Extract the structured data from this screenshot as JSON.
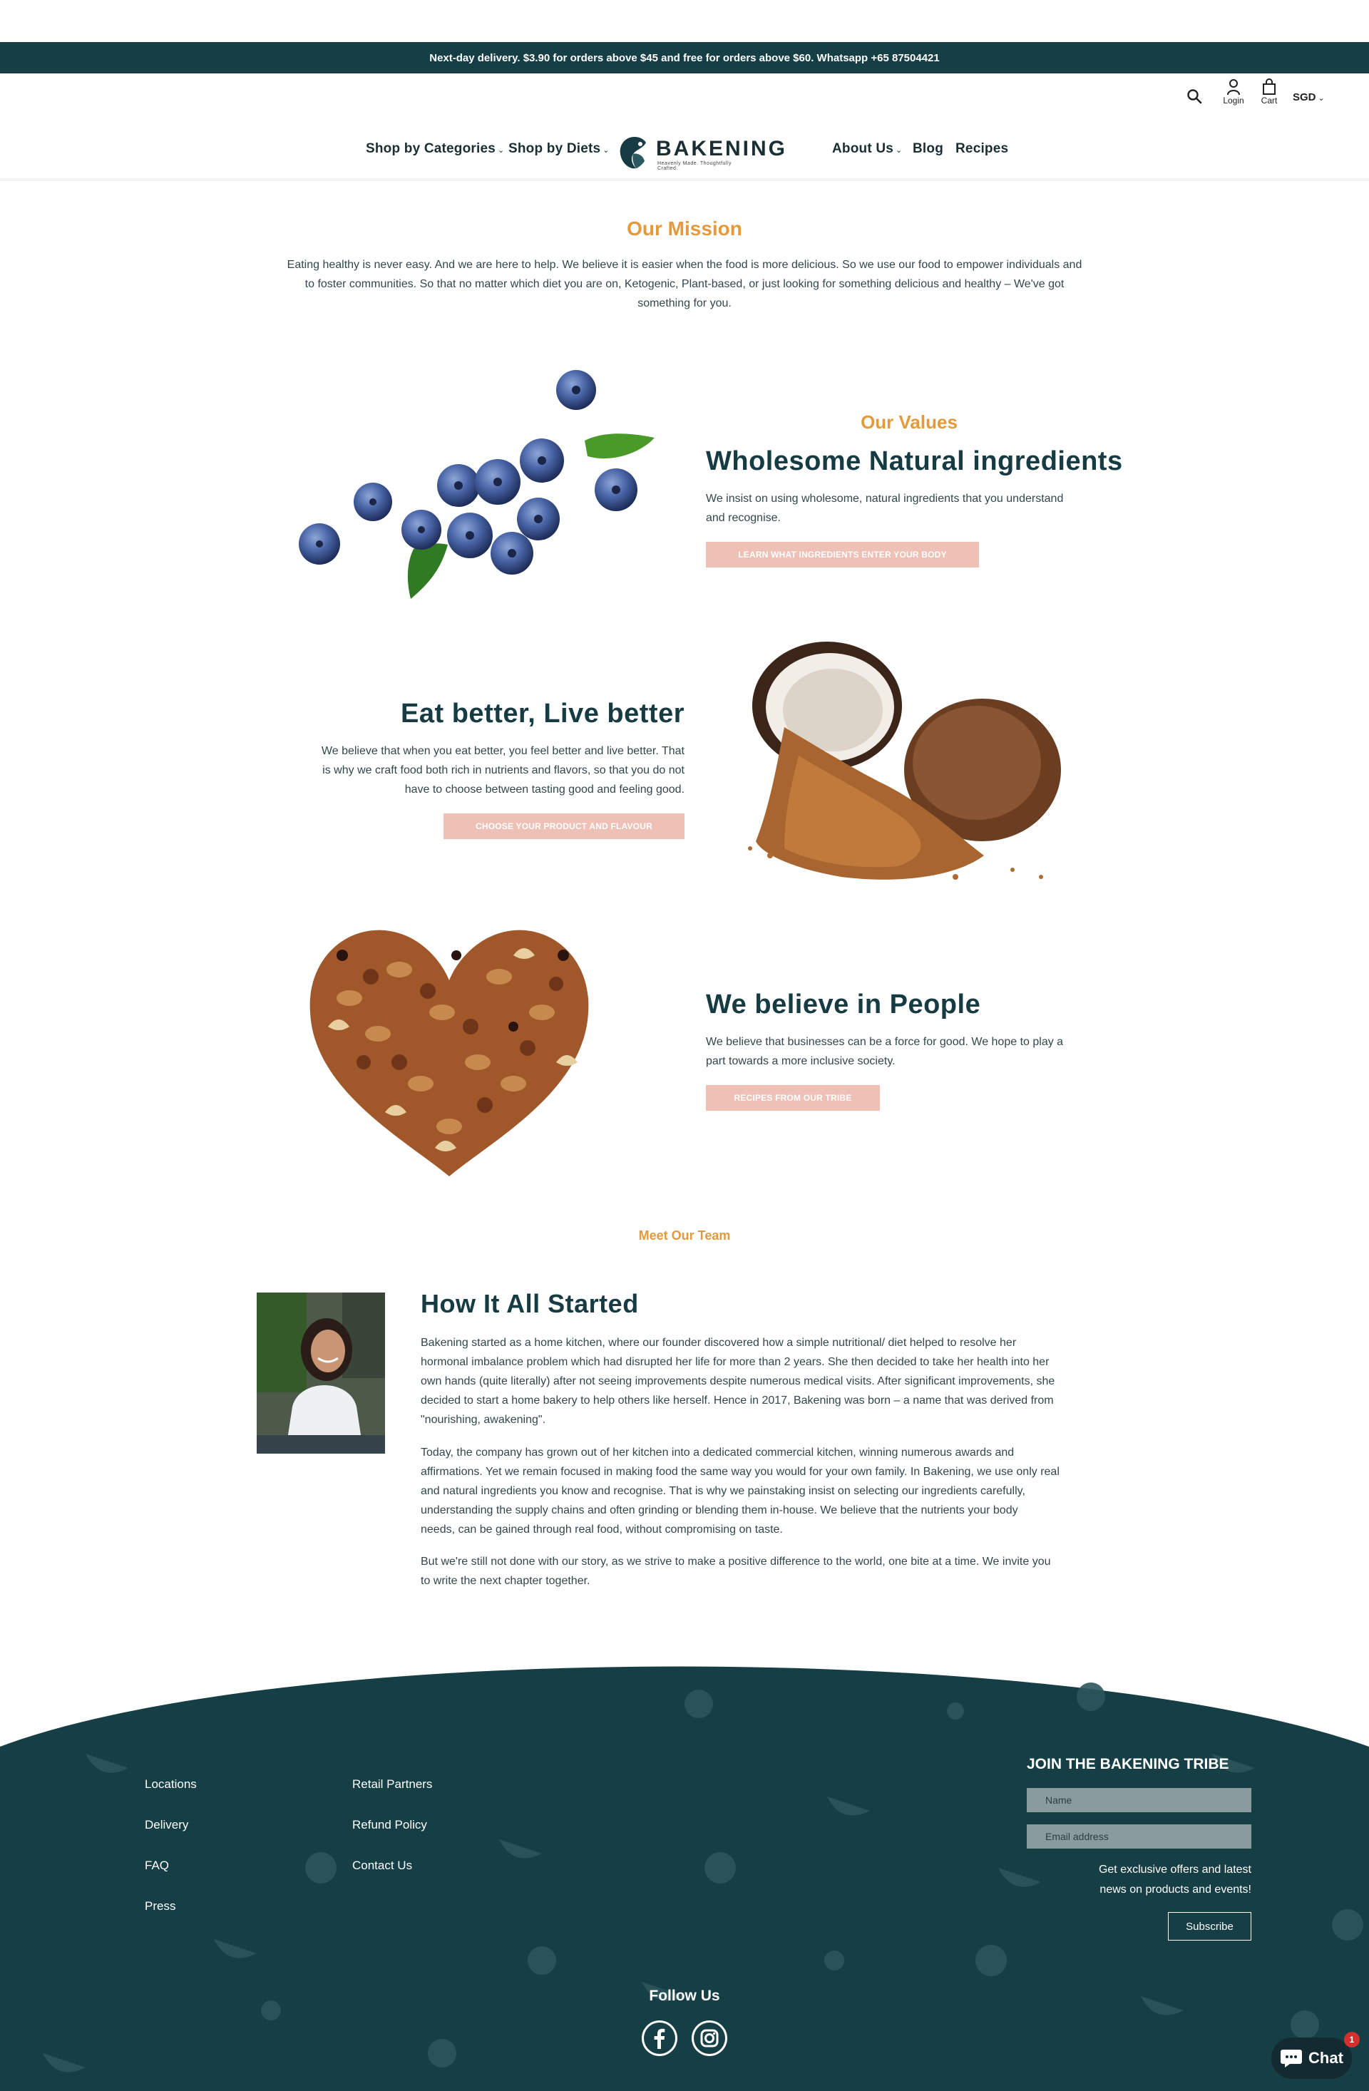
{
  "announcement": "Next-day delivery. $3.90 for orders above $45 and free for orders above $60. Whatsapp +65 87504421",
  "header": {
    "login_label": "Login",
    "cart_label": "Cart",
    "currency": "SGD",
    "nav_left": [
      "Shop by Categories",
      "Shop by Diets"
    ],
    "nav_right": [
      "About Us",
      "Blog",
      "Recipes"
    ],
    "logo_text": "BAKENING",
    "logo_tagline": "Heavenly Made. Thoughtfully Crafted."
  },
  "mission": {
    "title": "Our Mission",
    "line1": "Eating healthy is never easy. And we are here to help. We believe it is easier when the food is more delicious. So we use our food to empower individuals and",
    "line2": "to foster communities. So that no matter which diet you are on, Ketogenic, Plant-based, or just looking for something delicious and healthy – We've got",
    "line3": "something for you."
  },
  "values": {
    "eyebrow": "Our Values",
    "sections": [
      {
        "title": "Wholesome Natural ingredients",
        "line1": "We insist on using wholesome, natural ingredients that you understand",
        "line2": "and recognise.",
        "button": "Learn what ingredients enter your body"
      },
      {
        "title": "Eat better, Live better",
        "line1": "We believe that when you eat better, you feel better and live better. That",
        "line2": "is why we craft food both rich in nutrients and flavors, so that you do not",
        "line3": "have to choose between tasting good and feeling good.",
        "button": "Choose your product and flavour"
      },
      {
        "title": "We believe in People",
        "line1": "We believe that businesses can be a force for good. We hope to play a",
        "line2": "part towards a more inclusive society.",
        "button": "Recipes from our tribe"
      }
    ]
  },
  "team": {
    "eyebrow": "Meet Our Team",
    "title": "How It All Started",
    "p1": [
      "Bakening started as a home kitchen, where our founder discovered how a simple nutritional/ diet helped to resolve her",
      "hormonal imbalance problem which had disrupted her life for more than 2 years. She then decided to take her health into her",
      "own hands (quite literally) after not seeing improvements despite numerous medical visits. After significant improvements, she",
      "decided to start a home bakery to help others like herself. Hence in 2017, Bakening was born – a name that was derived from",
      "\"nourishing, awakening\"."
    ],
    "p2": [
      "Today, the company has grown out of her kitchen into a dedicated commercial kitchen, winning numerous awards and",
      "affirmations. Yet we remain focused in making food the same way you would for your own family. In Bakening, we use only real",
      "and natural ingredients you know and recognise. That is why we painstaking insist on selecting our ingredients carefully,",
      "understanding the supply chains and often grinding or blending them in-house. We believe that the nutrients your body",
      "needs, can be gained through real food, without compromising on taste."
    ],
    "p3": [
      "But we're still not done with our story, as we strive to make a positive difference to the world, one bite at a time. We invite you",
      "to write the next chapter together."
    ]
  },
  "footer": {
    "col1": [
      "Locations",
      "Delivery",
      "FAQ",
      "Press"
    ],
    "col2": [
      "Retail Partners",
      "Refund Policy",
      "Contact Us"
    ],
    "newsletter_title": "JOIN THE BAKENING TRIBE",
    "name_placeholder": "Name",
    "email_placeholder": "Email address",
    "offer_line1": "Get exclusive offers and latest",
    "offer_line2": "news on products and events!",
    "subscribe": "Subscribe",
    "follow": "Follow Us"
  },
  "chat": {
    "label": "Chat",
    "badge": "1"
  },
  "colors": {
    "teal": "#153e45",
    "orange": "#e49a3b",
    "pink_button": "#eec0b6"
  }
}
